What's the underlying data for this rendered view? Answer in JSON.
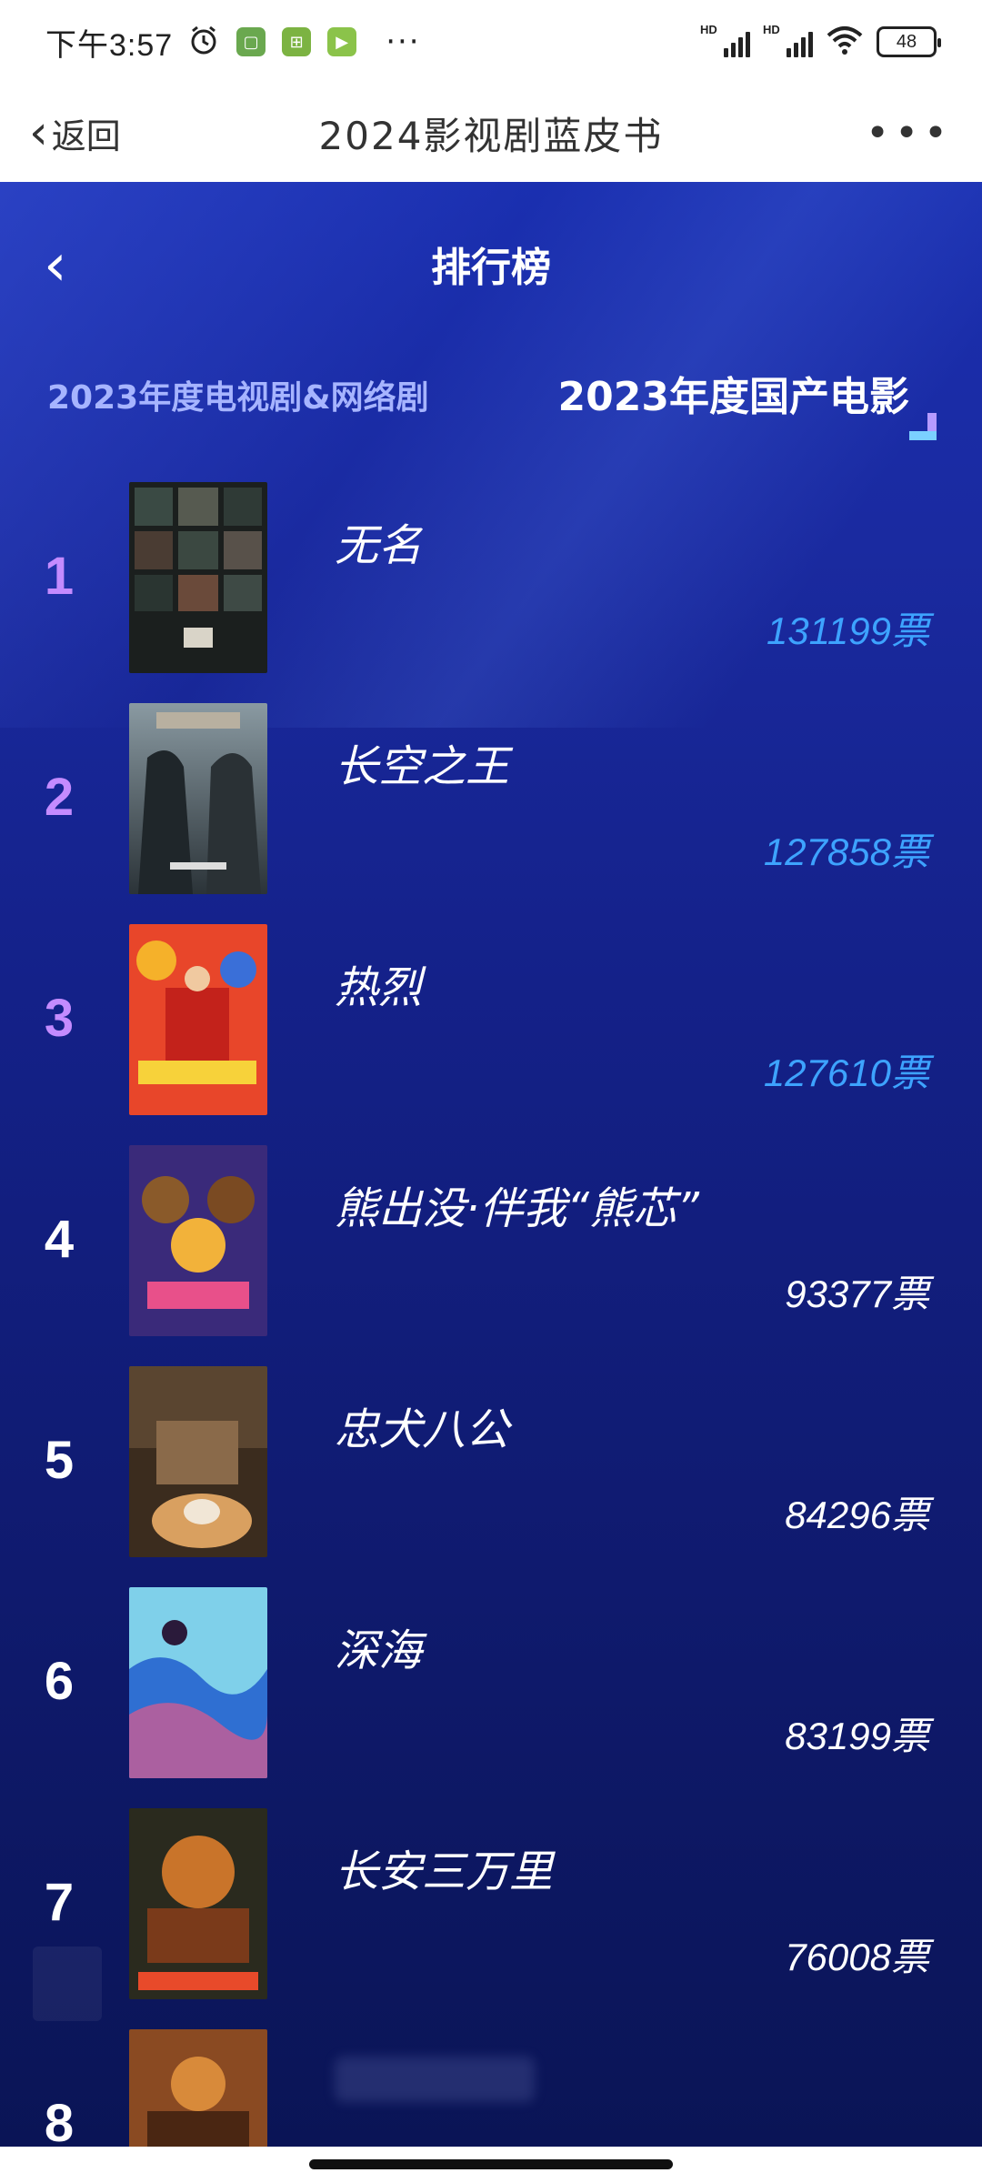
{
  "status_bar": {
    "time": "下午3:57",
    "more": "···",
    "hd1": "HD",
    "hd2": "HD",
    "battery": "48"
  },
  "nav": {
    "back_label": "返回",
    "title": "2024影视剧蓝皮书",
    "more": "•••"
  },
  "page": {
    "title": "排行榜"
  },
  "tabs": {
    "left": "2023年度电视剧&网络剧",
    "right": "2023年度国产电影"
  },
  "colors": {
    "top_rank": "#c48bff",
    "top_votes": "#3da3ff",
    "background": "#142189"
  },
  "movies": [
    {
      "rank": "1",
      "title": "无名",
      "votes": "131199票"
    },
    {
      "rank": "2",
      "title": "长空之王",
      "votes": "127858票"
    },
    {
      "rank": "3",
      "title": "热烈",
      "votes": "127610票"
    },
    {
      "rank": "4",
      "title": "熊出没·伴我“熊芯”",
      "votes": "93377票"
    },
    {
      "rank": "5",
      "title": "忠犬八公",
      "votes": "84296票"
    },
    {
      "rank": "6",
      "title": "深海",
      "votes": "83199票"
    },
    {
      "rank": "7",
      "title": "长安三万里",
      "votes": "76008票"
    },
    {
      "rank": "8",
      "title": "",
      "votes": ""
    }
  ]
}
